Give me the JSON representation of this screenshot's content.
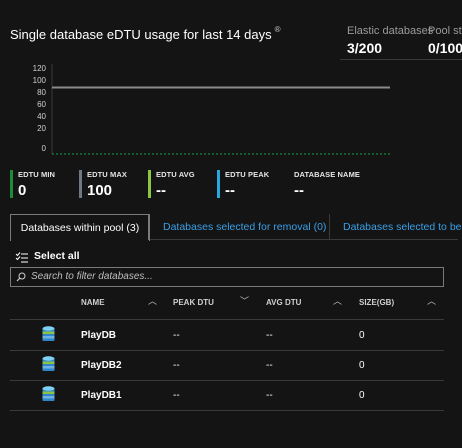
{
  "header": {
    "title": "Single database eDTU usage for last 14 days",
    "info_icon": "info-icon",
    "stats": [
      {
        "label": "Elastic databases",
        "value": "3/200"
      },
      {
        "label": "Pool sto",
        "value": "0/100"
      }
    ]
  },
  "chart_data": {
    "type": "line",
    "title": "Single database eDTU usage for last 14 days",
    "yticks": [
      "120",
      "100",
      "80",
      "60",
      "40",
      "20",
      "0"
    ],
    "ylim": [
      0,
      120
    ],
    "series": [
      {
        "values": [
          95,
          95,
          95,
          95,
          95,
          95,
          95,
          95,
          95,
          95,
          95,
          95,
          95,
          95
        ],
        "color": "#8a8a8a"
      },
      {
        "values": [
          0,
          0,
          0,
          0,
          0,
          0,
          0,
          0,
          0,
          0,
          0,
          0,
          0,
          0
        ],
        "color": "#1aa34a"
      }
    ],
    "grid": true
  },
  "metrics": [
    {
      "label": "EDTU MIN",
      "value": "0",
      "color": "#1e8a3a"
    },
    {
      "label": "EDTU MAX",
      "value": "100",
      "color": "#6d7a85"
    },
    {
      "label": "EDTU AVG",
      "value": "--",
      "color": "#8cc63f"
    },
    {
      "label": "EDTU PEAK",
      "value": "--",
      "color": "#29a8e0"
    },
    {
      "label": "DATABASE NAME",
      "value": "--",
      "color": "transparent"
    }
  ],
  "tabs": [
    {
      "label": "Databases within pool (3)"
    },
    {
      "label": "Databases selected for removal (0)"
    },
    {
      "label": "Databases selected to be ad"
    }
  ],
  "select_all": {
    "label": "Select all",
    "icon": "select-all-icon"
  },
  "search": {
    "placeholder": "Search to filter databases..."
  },
  "columns": [
    "NAME",
    "PEAK DTU",
    "AVG DTU",
    "SIZE(GB)"
  ],
  "rows": [
    {
      "name": "PlayDB",
      "peak": "--",
      "avg": "--",
      "size": "0"
    },
    {
      "name": "PlayDB2",
      "peak": "--",
      "avg": "--",
      "size": "0"
    },
    {
      "name": "PlayDB1",
      "peak": "--",
      "avg": "--",
      "size": "0"
    }
  ],
  "colors": {
    "accent": "#3aa0e8",
    "background": "#141414"
  }
}
